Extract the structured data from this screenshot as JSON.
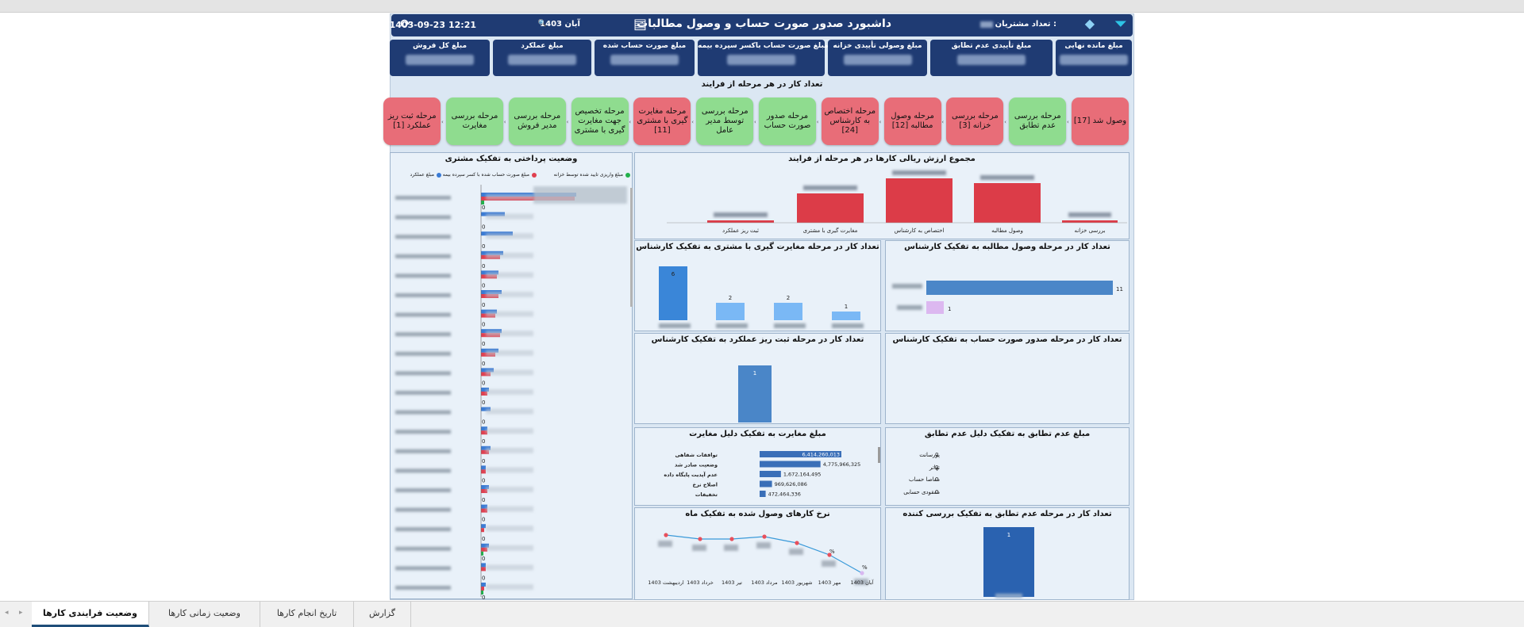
{
  "excel_sheet_tabs": [
    {
      "label": "وضعیت فرایندی کارها"
    },
    {
      "label": "وضعیت زمانی کارها"
    },
    {
      "label": "تاریخ انجام کارها"
    },
    {
      "label": "گزارش"
    }
  ],
  "header": {
    "title": "داشبورد صدور صورت حساب و وصول مطالبات",
    "customers_label": "تعداد مشتریان :",
    "month": "آبان 1403",
    "time": "12:21",
    "date": "1403-09-23"
  },
  "kpis": [
    {
      "label": "مبلغ مانده نهایی"
    },
    {
      "label": "مبلغ تأییدی عدم تطابق"
    },
    {
      "label": "مبلغ وصولی تأییدی خزانه"
    },
    {
      "label": "مبلغ صورت حساب باکسر سپرده بیمه"
    },
    {
      "label": "مبلغ صورت حساب شده"
    },
    {
      "label": "مبلغ عملکرد"
    },
    {
      "label": "مبلغ کل فروش"
    }
  ],
  "process": {
    "title": "تعداد کار در هر مرحله از فرایند",
    "steps": [
      {
        "label": "وصول شد [17]",
        "status": "red"
      },
      {
        "label": "مرحله بررسی عدم تطابق",
        "status": "green"
      },
      {
        "label": "مرحله بررسی خزانه [3]",
        "status": "red"
      },
      {
        "label": "مرحله وصول مطالبه [12]",
        "status": "red"
      },
      {
        "label": "مرحله اختصاص به کارشناس [24]",
        "status": "red"
      },
      {
        "label": "مرحله صدور صورت حساب",
        "status": "green"
      },
      {
        "label": "مرحله بررسی توسط مدیر عامل",
        "status": "green"
      },
      {
        "label": "مرحله مغایرت گیری با مشتری [11]",
        "status": "red"
      },
      {
        "label": "مرحله تخصیص جهت مغایرت گیری با مشتری",
        "status": "green"
      },
      {
        "label": "مرحله بررسی مدیر فروش",
        "status": "green"
      },
      {
        "label": "مرحله بررسی مغایرت",
        "status": "green"
      },
      {
        "label": "مرحله ثبت ریز عملکرد [1]",
        "status": "red"
      }
    ]
  },
  "payment_panel": {
    "title": "وضعیت پرداختی به تفکیک مشتری",
    "legend": [
      {
        "label": "مبلغ واریزی تایید شده توسط خزانه",
        "color": "#22b14c"
      },
      {
        "label": "مبلغ صورت حساب شده با کسر سپرده بیمه",
        "color": "#e04050"
      },
      {
        "label": "مبلغ عملکرد",
        "color": "#3a7bd5"
      }
    ],
    "zero_label": "0"
  },
  "value_panel": {
    "title": "مجموع ارزش ریالی کارها در هر مرحله از فرایند",
    "categories": [
      "بررسی خزانه",
      "وصول مطالبه",
      "اختصاص به کارشناس",
      "مغایرت گیری با مشتری",
      "ثبت ریز عملکرد"
    ]
  },
  "collection_panel": {
    "title": "تعداد کار در مرحله وصول مطالبه به تفکیک کارشناس",
    "values": [
      11,
      1
    ]
  },
  "reconcile_panel": {
    "title": "تعداد کار در مرحله مغایرت گیری با مشتری به تفکیک کارشناس",
    "values": [
      1,
      2,
      2,
      6
    ]
  },
  "invoice_panel": {
    "title": "تعداد کار در مرحله صدور صورت حساب به تفکیک کارشناس"
  },
  "performance_panel": {
    "title": "تعداد کار در مرحله ثبت ریز عملکرد به تفکیک کارشناس",
    "values": [
      1
    ]
  },
  "mismatch_amount_panel": {
    "title": "مبلغ عدم تطابق به تفکیک دلیل عدم تطابق",
    "rows": [
      {
        "label": "پورسانت",
        "value": "0"
      },
      {
        "label": "تهاتر",
        "value": "0"
      },
      {
        "label": "مفاصا حساب",
        "value": "0"
      },
      {
        "label": "مفقودی حسابی",
        "value": "0"
      }
    ]
  },
  "discrepancy_panel": {
    "title": "مبلغ مغایرت به تفکیک دلیل مغایرت",
    "rows": [
      {
        "label": "توافقات شفاهی",
        "value": "6,414,260,013",
        "amount": 6414260013
      },
      {
        "label": "وضعیت صادر شد",
        "value": "4,775,966,325",
        "amount": 4775966325
      },
      {
        "label": "عدم آپدیت پایگاه داده",
        "value": "1,672,164,495",
        "amount": 1672164495
      },
      {
        "label": "اصلاح نرخ",
        "value": "969,626,086",
        "amount": 969626086
      },
      {
        "label": "تخفیفات",
        "value": "472,464,336",
        "amount": 472464336
      }
    ]
  },
  "mismatch_count_panel": {
    "title": "تعداد کار در مرحله عدم تطابق به تفکیک بررسی کننده",
    "values": [
      1
    ]
  },
  "monthly_panel": {
    "title": "نرخ کارهای وصول شده به تفکیک ماه",
    "months": [
      "آبان 1403",
      "مهر 1403",
      "شهریور 1403",
      "مرداد 1403",
      "تیر 1403",
      "خرداد 1403",
      "اردیبهشت 1403"
    ],
    "percent_label": "%"
  },
  "colors": {
    "header": "#1f3b73",
    "green_step": "#8fdc8f",
    "red_step": "#e86d78",
    "panel": "#e9f1f9",
    "accent_blue": "#3a7bd5",
    "bar_red": "#dc3c48"
  }
}
